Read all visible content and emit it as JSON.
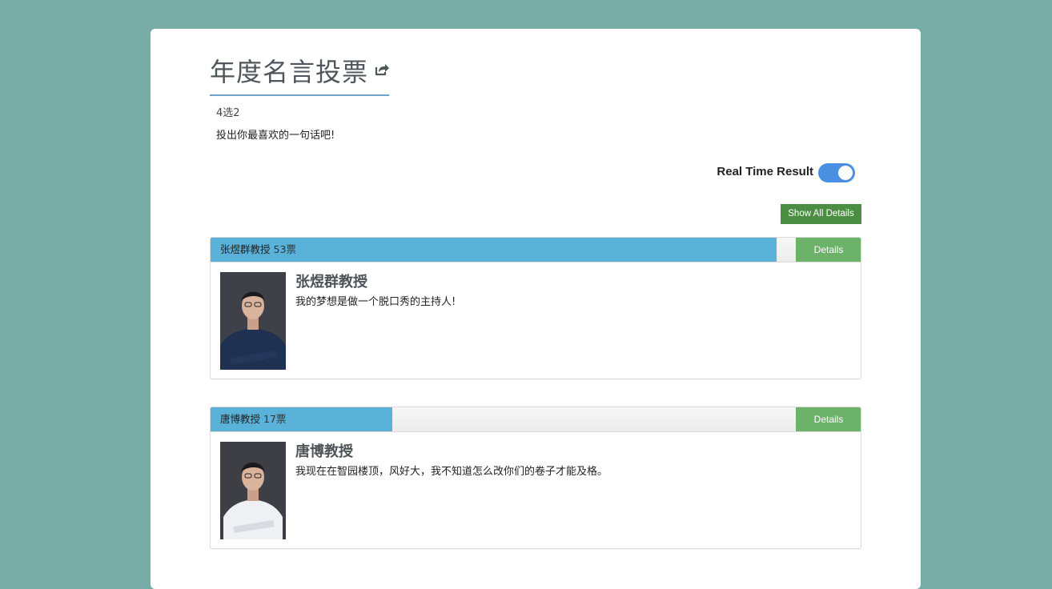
{
  "poll": {
    "title": "年度名言投票",
    "limit_text": "4选2",
    "description": "投出你最喜欢的一句话吧!"
  },
  "realtime": {
    "label": "Real Time Result",
    "enabled": true
  },
  "show_all_label": "Show All Details",
  "candidates": [
    {
      "bar_name": "张煜群教授",
      "votes_text": "53票",
      "votes": 53,
      "details_label": "Details",
      "name": "张煜群教授",
      "quote": "我的梦想是做一个脱口秀的主持人!",
      "shirt_color": "#1f3050"
    },
    {
      "bar_name": "唐博教授",
      "votes_text": "17票",
      "votes": 17,
      "details_label": "Details",
      "name": "唐博教授",
      "quote": "我现在在智园楼顶，风好大，我不知道怎么改你们的卷子才能及格。",
      "shirt_color": "#eef0f4"
    }
  ],
  "colors": {
    "background": "#77ada6",
    "bar_fill": "#5bb2d8",
    "details_button": "#6db26b",
    "show_all_button": "#4b8e43",
    "toggle": "#4a90e2"
  }
}
